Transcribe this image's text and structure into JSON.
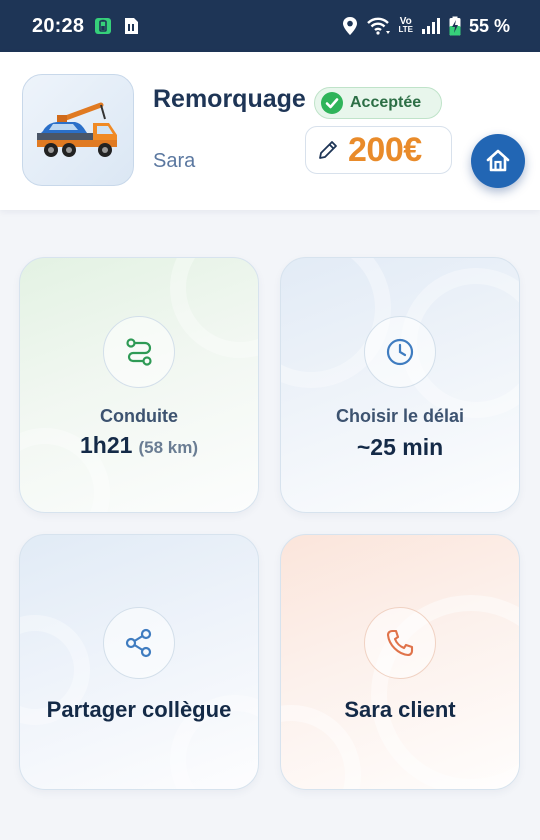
{
  "status_bar": {
    "time": "20:28",
    "battery_percent": "55 %",
    "network_label_top": "Vo",
    "network_label_bottom": "LTE",
    "icons": [
      "battery-saver-icon",
      "sim-icon",
      "location-icon",
      "wifi-icon",
      "signal-icon",
      "battery-charging-icon"
    ]
  },
  "header": {
    "title": "Remorquage",
    "subtitle": "Sara",
    "status_badge": "Acceptée",
    "price": "200€",
    "thumbnail_icon": "tow-truck-icon",
    "home_icon": "home-icon",
    "edit_icon": "pencil-icon"
  },
  "tiles": [
    {
      "id": "conduite",
      "icon": "route-icon",
      "label": "Conduite",
      "value": "1h21",
      "sub": "(58 km)",
      "accent": "#2e9a55"
    },
    {
      "id": "delai",
      "icon": "clock-icon",
      "label": "Choisir le délai",
      "value": "~25 min",
      "accent": "#3f7cc0"
    },
    {
      "id": "partager",
      "icon": "share-icon",
      "label": "Partager collègue",
      "accent": "#3f7cc0"
    },
    {
      "id": "client",
      "icon": "phone-icon",
      "label": "Sara client",
      "accent": "#e0734a"
    }
  ],
  "colors": {
    "status_bar_bg": "#1e3556",
    "title": "#1e3556",
    "price": "#e98b2a",
    "badge_green": "#2fb45a",
    "home_button": "#2266b4"
  }
}
